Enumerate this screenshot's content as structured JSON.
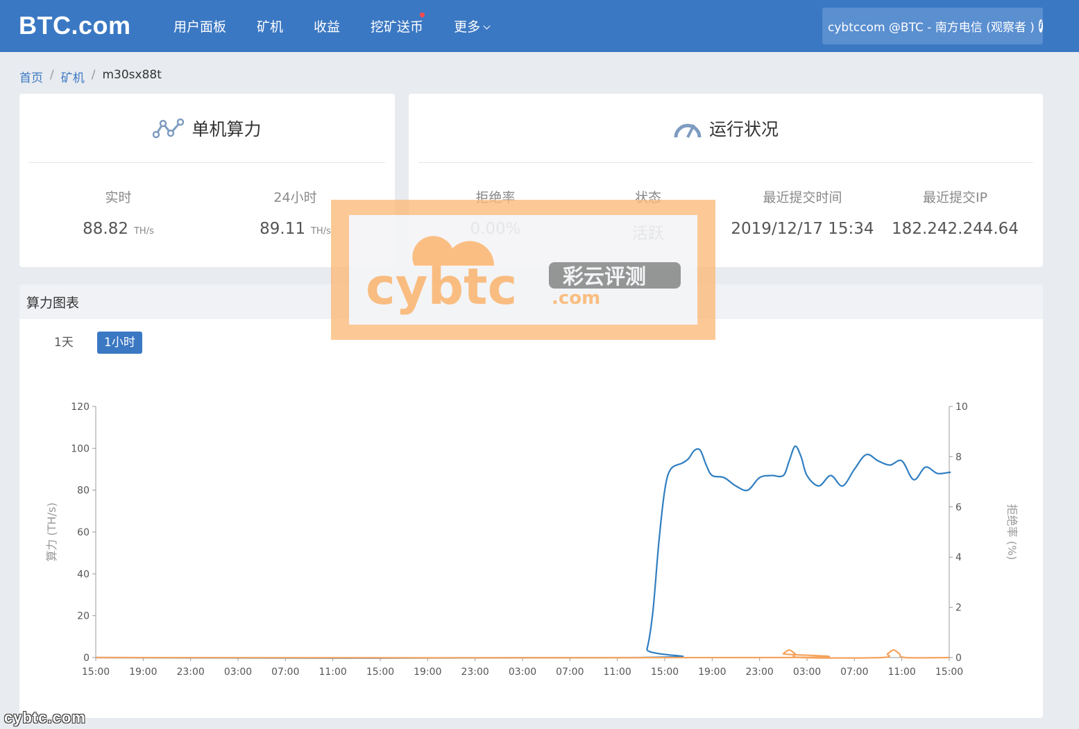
{
  "header": {
    "logo": "BTC.com",
    "nav": [
      "用户面板",
      "矿机",
      "收益",
      "挖矿送币",
      "更多"
    ],
    "account": "cybtccom @BTC - 南方电信 (观察者 )"
  },
  "breadcrumb": {
    "home": "首页",
    "miners": "矿机",
    "current": "m30sx88t"
  },
  "hashrate_card": {
    "title": "单机算力",
    "realtime_label": "实时",
    "realtime_value": "88.82",
    "day_label": "24小时",
    "day_value": "89.11",
    "unit": "TH/s"
  },
  "status_card": {
    "title": "运行状况",
    "reject_label": "拒绝率",
    "reject_value": "0.00%",
    "state_label": "状态",
    "state_value": "活跃",
    "last_submit_label": "最近提交时间",
    "last_submit_value": "2019/12/17 15:34",
    "last_ip_label": "最近提交IP",
    "last_ip_value": "182.242.244.64"
  },
  "chart_section": {
    "title": "算力图表",
    "range_day": "1天",
    "range_hour": "1小时"
  },
  "watermark": {
    "brand": "cybtc",
    "domain": ".com",
    "cn": "彩云评测",
    "corner": "cybtc.com"
  },
  "chart_data": {
    "type": "line",
    "x": [
      "15:00",
      "19:00",
      "23:00",
      "03:00",
      "07:00",
      "11:00",
      "15:00",
      "19:00",
      "23:00",
      "03:00",
      "07:00",
      "11:00",
      "15:00",
      "19:00",
      "23:00",
      "03:00",
      "07:00",
      "11:00",
      "15:00"
    ],
    "ylabel": "算力 (TH/s)",
    "y2label": "拒绝率 (%)",
    "ylim": [
      0,
      120
    ],
    "y2lim": [
      0,
      10
    ],
    "yticks": [
      0,
      20,
      40,
      60,
      80,
      100,
      120
    ],
    "y2ticks": [
      0,
      2,
      4,
      6,
      8,
      10
    ],
    "series": [
      {
        "axis": "left",
        "color": "#2f7ec1",
        "values": [
          [
            0,
            0
          ],
          [
            46,
            0
          ],
          [
            46.5,
            4
          ],
          [
            47,
            22
          ],
          [
            47.5,
            55
          ],
          [
            48,
            80
          ],
          [
            48.5,
            90
          ],
          [
            49.5,
            93
          ],
          [
            50,
            95
          ],
          [
            50.5,
            99
          ],
          [
            51,
            99
          ],
          [
            51.5,
            92
          ],
          [
            52,
            87
          ],
          [
            53,
            86
          ],
          [
            54,
            82
          ],
          [
            55,
            80
          ],
          [
            56,
            86
          ],
          [
            57,
            87
          ],
          [
            58,
            87
          ],
          [
            58.5,
            94
          ],
          [
            59,
            101
          ],
          [
            59.5,
            96
          ],
          [
            60,
            87
          ],
          [
            61,
            82
          ],
          [
            62,
            87
          ],
          [
            63,
            82
          ],
          [
            64,
            90
          ],
          [
            65,
            97
          ],
          [
            66,
            94
          ],
          [
            67,
            92
          ],
          [
            68,
            94
          ],
          [
            69,
            85
          ],
          [
            70,
            91
          ],
          [
            71,
            88
          ],
          [
            72,
            88.5
          ],
          [
            72,
            88.5
          ]
        ]
      },
      {
        "axis": "right",
        "color": "#f5a35c",
        "values": [
          [
            0,
            0
          ],
          [
            57.5,
            0
          ],
          [
            58,
            0.15
          ],
          [
            58.5,
            0.3
          ],
          [
            59,
            0.15
          ],
          [
            59.5,
            0
          ],
          [
            66.3,
            0
          ],
          [
            66.8,
            0.15
          ],
          [
            67.3,
            0.3
          ],
          [
            67.8,
            0.15
          ],
          [
            68.3,
            0
          ],
          [
            72,
            0
          ]
        ]
      }
    ],
    "grid": false,
    "legend": "none"
  }
}
